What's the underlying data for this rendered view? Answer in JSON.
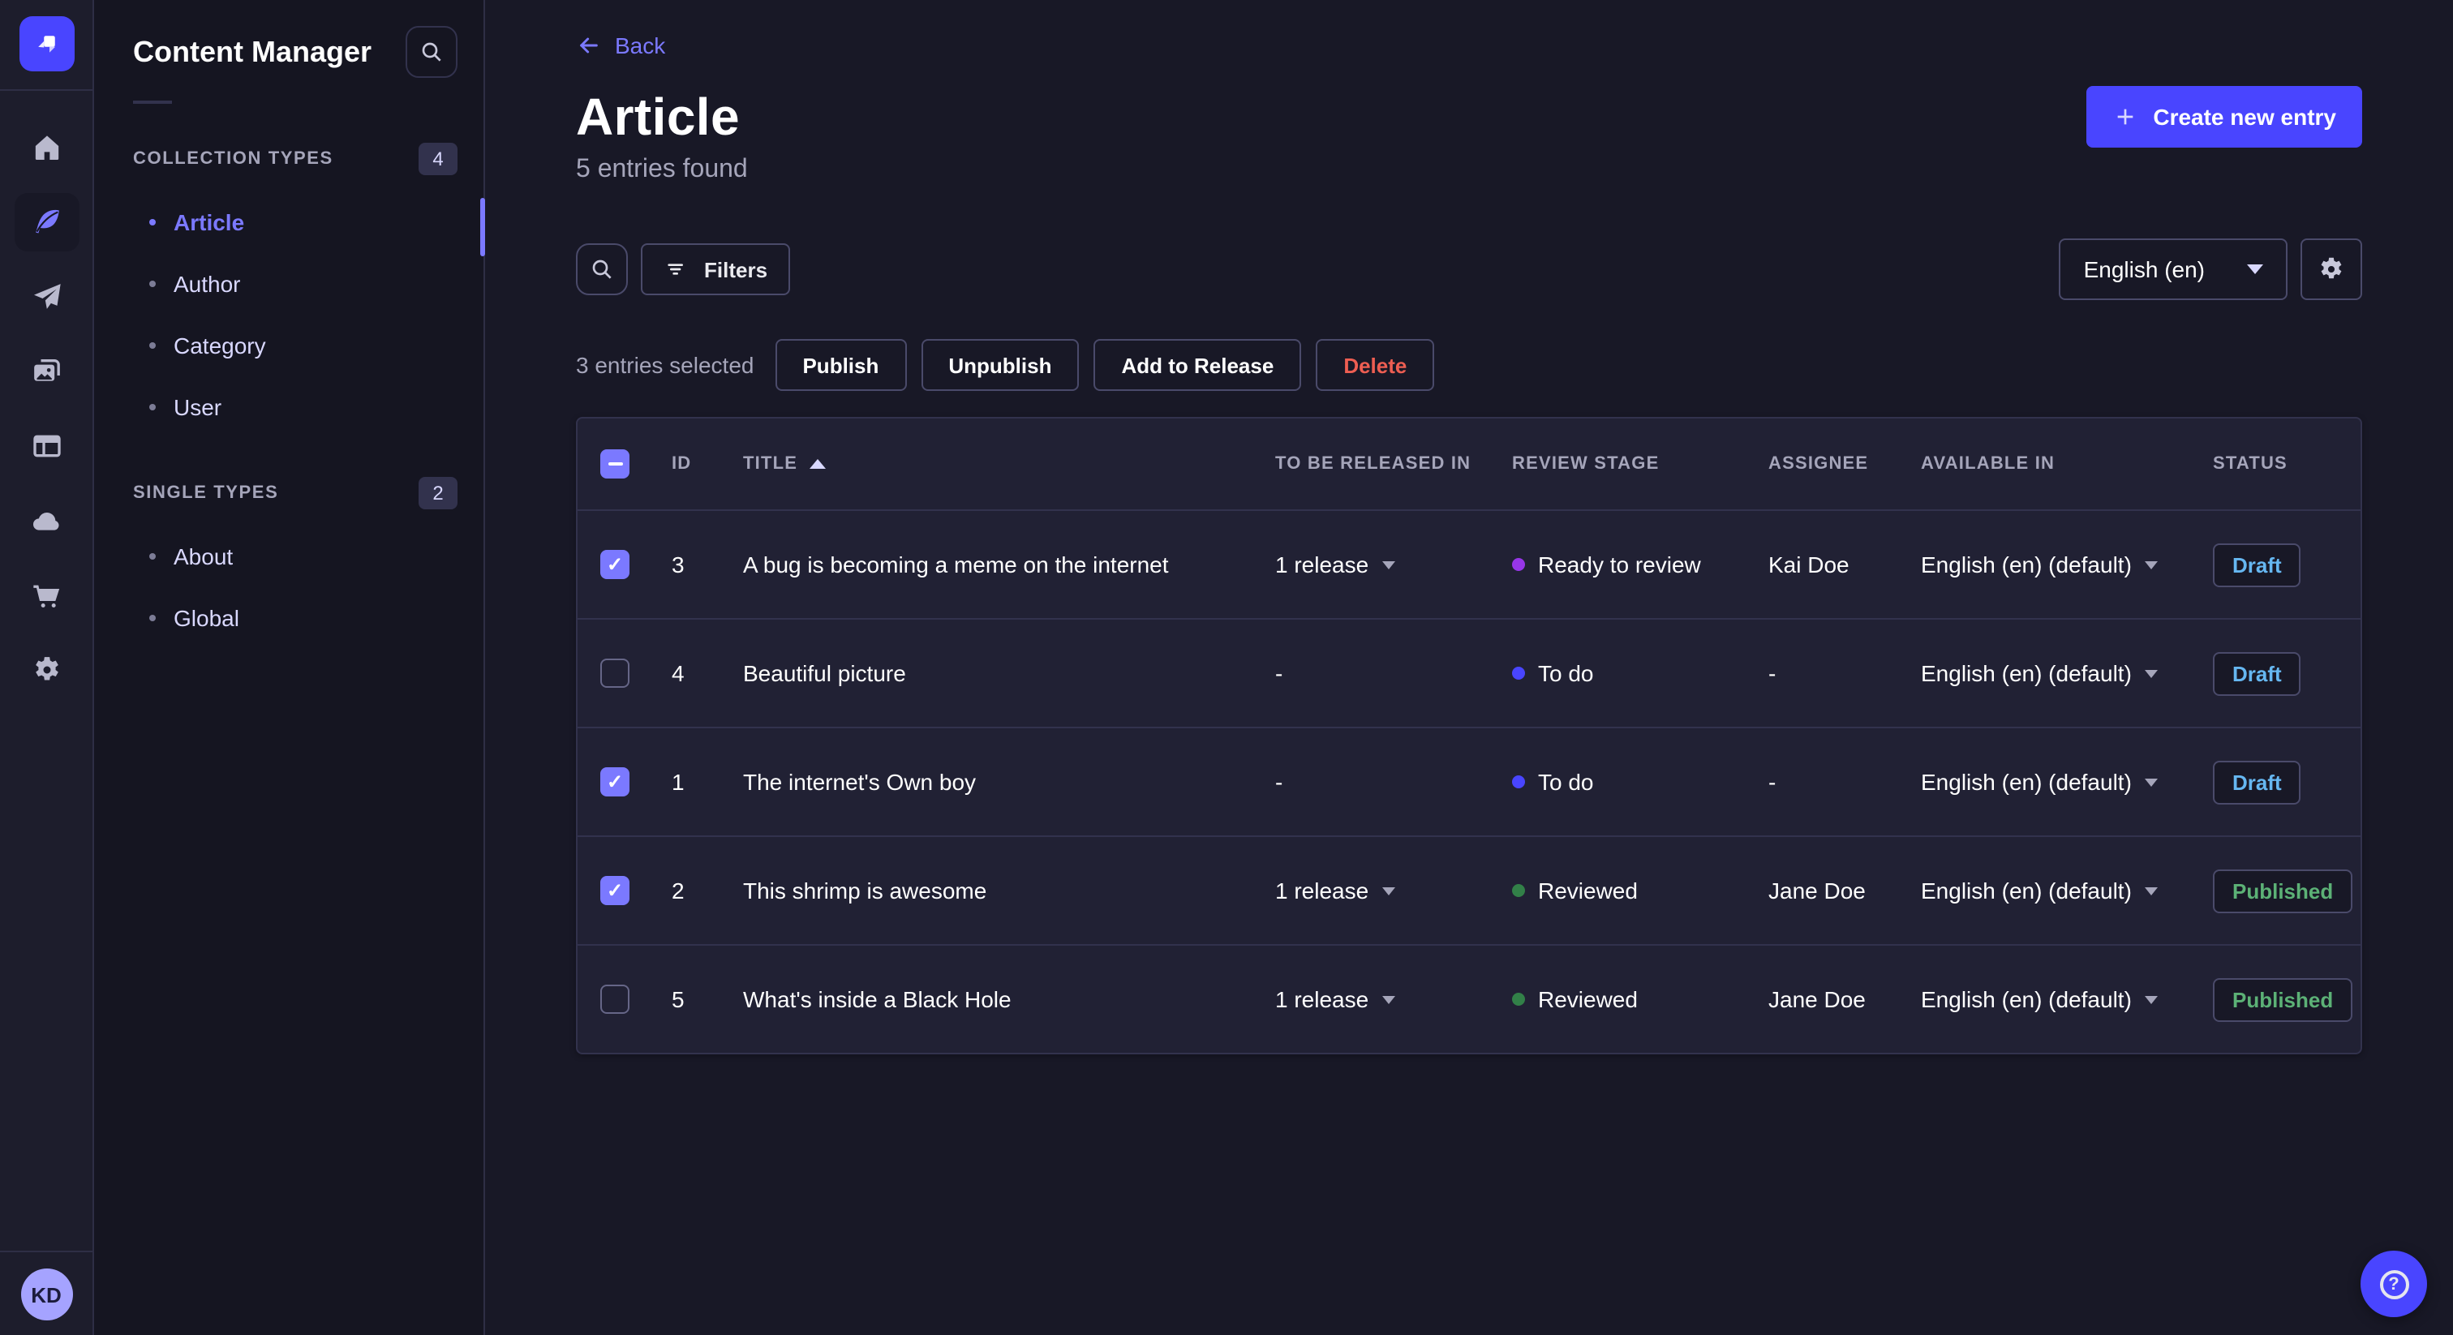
{
  "colors": {
    "accent": "#4945ff",
    "accent_light": "#7b79ff",
    "page_bg": "#181826",
    "card_bg": "#212134",
    "border": "#32324d",
    "text_muted": "#a5a5ba",
    "danger": "#ee5e52",
    "draft_text": "#66b7f1",
    "published_text": "#5cb176"
  },
  "nav": {
    "avatar_initials": "KD",
    "items": [
      {
        "name": "home",
        "active": false
      },
      {
        "name": "content-manager",
        "active": true
      },
      {
        "name": "releases",
        "active": false
      },
      {
        "name": "media-library",
        "active": false
      },
      {
        "name": "content-type-builder",
        "active": false
      },
      {
        "name": "cloud",
        "active": false
      },
      {
        "name": "marketplace",
        "active": false
      },
      {
        "name": "settings",
        "active": false
      }
    ]
  },
  "subnav": {
    "title": "Content Manager",
    "sections": [
      {
        "label": "COLLECTION TYPES",
        "count": "4",
        "items": [
          {
            "label": "Article",
            "active": true
          },
          {
            "label": "Author",
            "active": false
          },
          {
            "label": "Category",
            "active": false
          },
          {
            "label": "User",
            "active": false
          }
        ]
      },
      {
        "label": "SINGLE TYPES",
        "count": "2",
        "items": [
          {
            "label": "About",
            "active": false
          },
          {
            "label": "Global",
            "active": false
          }
        ]
      }
    ]
  },
  "header": {
    "back": "Back",
    "title": "Article",
    "subtitle": "5 entries found",
    "create_button": "Create new entry"
  },
  "toolbar": {
    "filters": "Filters",
    "locale": "English (en)"
  },
  "selection": {
    "summary": "3 entries selected",
    "publish": "Publish",
    "unpublish": "Unpublish",
    "add_to_release": "Add to Release",
    "delete": "Delete"
  },
  "table": {
    "headers": {
      "id": "ID",
      "title": "TITLE",
      "released": "TO BE RELEASED IN",
      "review": "REVIEW STAGE",
      "assignee": "ASSIGNEE",
      "available": "AVAILABLE IN",
      "status": "STATUS"
    },
    "rows": [
      {
        "checkbox": "checked",
        "id": "3",
        "title": "A bug is becoming a meme on the internet",
        "release": "1 release",
        "stage": "Ready to review",
        "stage_color": "#9736e8",
        "assignee": "Kai Doe",
        "available": "English (en) (default)",
        "status": "Draft"
      },
      {
        "checkbox": "unchecked",
        "id": "4",
        "title": "Beautiful picture",
        "release": "-",
        "stage": "To do",
        "stage_color": "#4945ff",
        "assignee": "-",
        "available": "English (en) (default)",
        "status": "Draft"
      },
      {
        "checkbox": "checked",
        "id": "1",
        "title": "The internet's Own boy",
        "release": "-",
        "stage": "To do",
        "stage_color": "#4945ff",
        "assignee": "-",
        "available": "English (en) (default)",
        "status": "Draft"
      },
      {
        "checkbox": "checked",
        "id": "2",
        "title": "This shrimp is awesome",
        "release": "1 release",
        "stage": "Reviewed",
        "stage_color": "#328048",
        "assignee": "Jane Doe",
        "available": "English (en) (default)",
        "status": "Published"
      },
      {
        "checkbox": "unchecked",
        "id": "5",
        "title": "What's inside a Black Hole",
        "release": "1 release",
        "stage": "Reviewed",
        "stage_color": "#328048",
        "assignee": "Jane Doe",
        "available": "English (en) (default)",
        "status": "Published"
      }
    ]
  }
}
